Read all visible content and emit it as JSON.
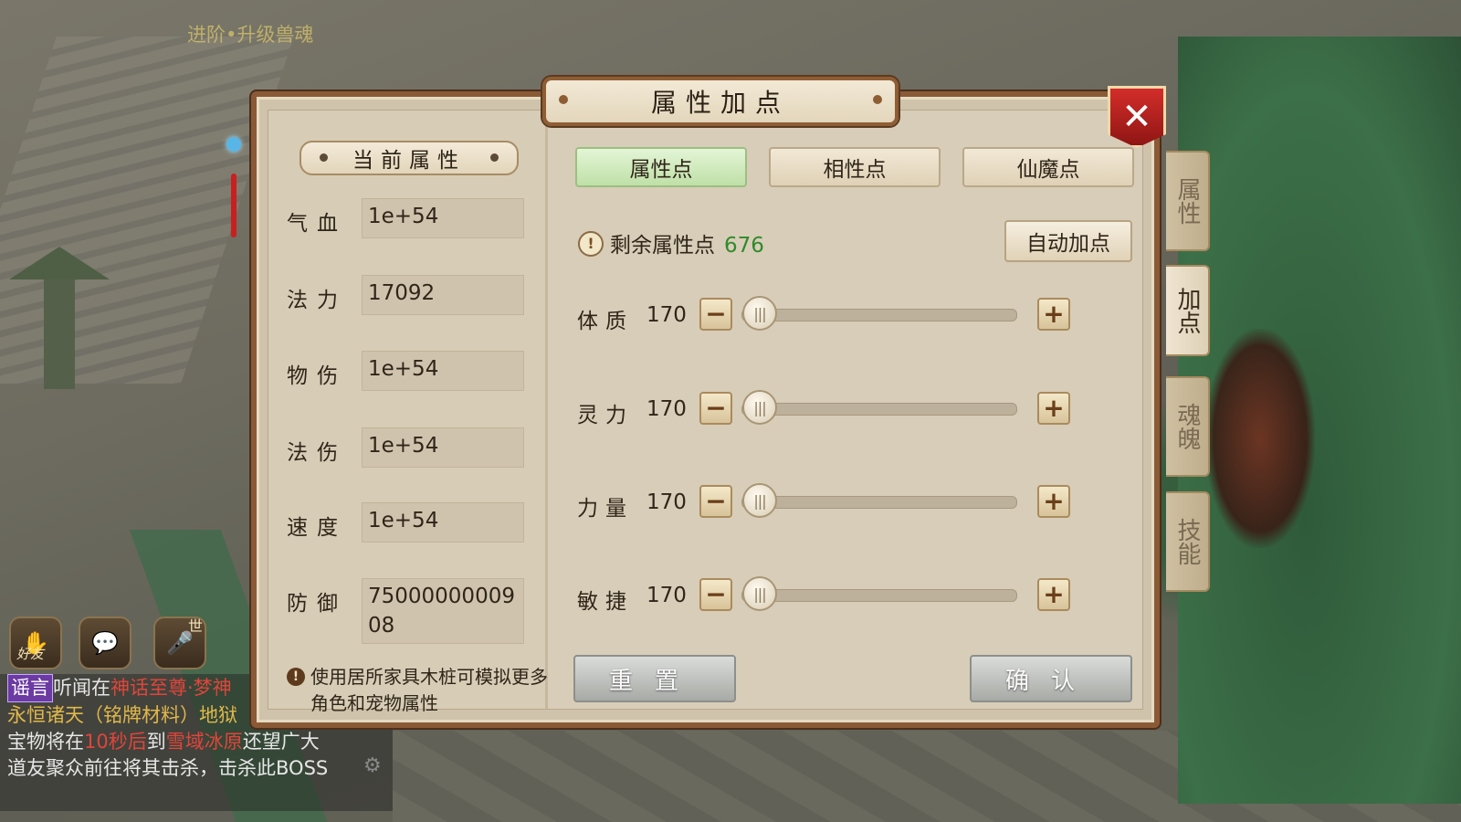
{
  "background": {
    "quest_tip": "进阶•升级兽魂",
    "hud": {
      "friends_label": "好友",
      "world_tag": "世"
    },
    "chat": {
      "tag": "谣言",
      "line1_a": "听闻在",
      "line1_b": "神话至尊·梦神",
      "line2": "永恒诸天（铭牌材料）地狱",
      "line3_a": "宝物将在",
      "line3_b": "10秒后",
      "line3_c": "到",
      "line3_d": "雪域冰原",
      "line3_e": "还望广大",
      "line4": "道友聚众前往将其击杀，击杀此BOSS"
    }
  },
  "panel": {
    "title": "属性加点",
    "current_title": "当前属性",
    "attributes": [
      {
        "label": "气血",
        "value": "1e+54"
      },
      {
        "label": "法力",
        "value": "17092"
      },
      {
        "label": "物伤",
        "value": "1e+54"
      },
      {
        "label": "法伤",
        "value": "1e+54"
      },
      {
        "label": "速度",
        "value": "1e+54"
      },
      {
        "label": "防御",
        "value": "7500000000908"
      }
    ],
    "note": "使用居所家具木桩可模拟更多角色和宠物属性",
    "tabs": [
      {
        "label": "属性点",
        "active": true
      },
      {
        "label": "相性点",
        "active": false
      },
      {
        "label": "仙魔点",
        "active": false
      }
    ],
    "remaining_label": "剩余属性点",
    "remaining_value": "676",
    "auto_button": "自动加点",
    "sliders": [
      {
        "label": "体质",
        "value": "170",
        "fill": 0
      },
      {
        "label": "灵力",
        "value": "170",
        "fill": 0
      },
      {
        "label": "力量",
        "value": "170",
        "fill": 0
      },
      {
        "label": "敏捷",
        "value": "170",
        "fill": 0
      }
    ],
    "reset_button": "重置",
    "confirm_button": "确认",
    "side_tabs": [
      {
        "label": "属性",
        "active": false
      },
      {
        "label": "加点",
        "active": true
      },
      {
        "label": "魂魄",
        "active": false
      },
      {
        "label": "技能",
        "active": false
      }
    ],
    "colors": {
      "remaining_value": "#2f8a2a",
      "active_tab": "#bfe0a8",
      "close_button": "#c62624"
    }
  }
}
